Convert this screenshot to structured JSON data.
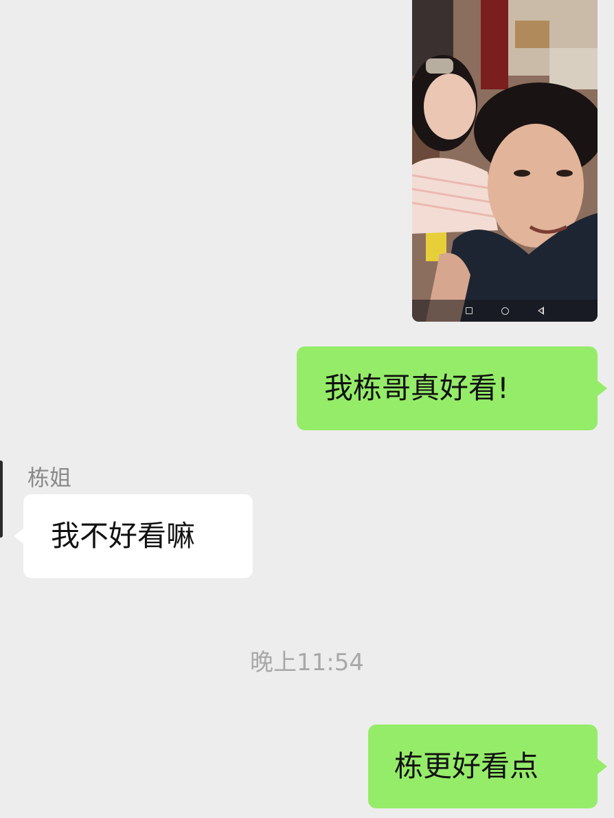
{
  "messages": [
    {
      "type": "image",
      "direction": "sent"
    },
    {
      "type": "text",
      "direction": "sent",
      "text": "我栋哥真好看!"
    },
    {
      "type": "text",
      "direction": "received",
      "sender": "栋姐",
      "text": "我不好看嘛"
    },
    {
      "type": "timestamp",
      "text": "晚上11:54"
    },
    {
      "type": "text",
      "direction": "sent",
      "text": "栋更好看点"
    }
  ],
  "colors": {
    "background": "#ededed",
    "sent_bubble": "#95ec69",
    "received_bubble": "#ffffff",
    "name_text": "#8a8a8a",
    "timestamp_text": "#a8a8a8"
  },
  "icons": [
    "nav-recents-icon",
    "nav-home-icon",
    "nav-back-icon"
  ]
}
